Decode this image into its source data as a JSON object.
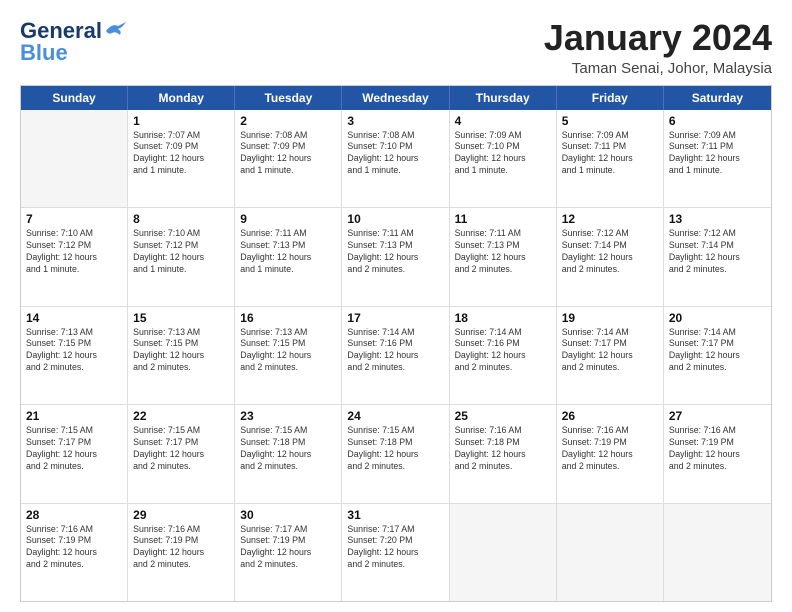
{
  "header": {
    "logo_top": "General",
    "logo_bottom": "Blue",
    "month_title": "January 2024",
    "location": "Taman Senai, Johor, Malaysia"
  },
  "calendar": {
    "days_of_week": [
      "Sunday",
      "Monday",
      "Tuesday",
      "Wednesday",
      "Thursday",
      "Friday",
      "Saturday"
    ],
    "weeks": [
      [
        {
          "day": "",
          "info": ""
        },
        {
          "day": "1",
          "info": "Sunrise: 7:07 AM\nSunset: 7:09 PM\nDaylight: 12 hours\nand 1 minute."
        },
        {
          "day": "2",
          "info": "Sunrise: 7:08 AM\nSunset: 7:09 PM\nDaylight: 12 hours\nand 1 minute."
        },
        {
          "day": "3",
          "info": "Sunrise: 7:08 AM\nSunset: 7:10 PM\nDaylight: 12 hours\nand 1 minute."
        },
        {
          "day": "4",
          "info": "Sunrise: 7:09 AM\nSunset: 7:10 PM\nDaylight: 12 hours\nand 1 minute."
        },
        {
          "day": "5",
          "info": "Sunrise: 7:09 AM\nSunset: 7:11 PM\nDaylight: 12 hours\nand 1 minute."
        },
        {
          "day": "6",
          "info": "Sunrise: 7:09 AM\nSunset: 7:11 PM\nDaylight: 12 hours\nand 1 minute."
        }
      ],
      [
        {
          "day": "7",
          "info": "Sunrise: 7:10 AM\nSunset: 7:12 PM\nDaylight: 12 hours\nand 1 minute."
        },
        {
          "day": "8",
          "info": "Sunrise: 7:10 AM\nSunset: 7:12 PM\nDaylight: 12 hours\nand 1 minute."
        },
        {
          "day": "9",
          "info": "Sunrise: 7:11 AM\nSunset: 7:13 PM\nDaylight: 12 hours\nand 1 minute."
        },
        {
          "day": "10",
          "info": "Sunrise: 7:11 AM\nSunset: 7:13 PM\nDaylight: 12 hours\nand 2 minutes."
        },
        {
          "day": "11",
          "info": "Sunrise: 7:11 AM\nSunset: 7:13 PM\nDaylight: 12 hours\nand 2 minutes."
        },
        {
          "day": "12",
          "info": "Sunrise: 7:12 AM\nSunset: 7:14 PM\nDaylight: 12 hours\nand 2 minutes."
        },
        {
          "day": "13",
          "info": "Sunrise: 7:12 AM\nSunset: 7:14 PM\nDaylight: 12 hours\nand 2 minutes."
        }
      ],
      [
        {
          "day": "14",
          "info": "Sunrise: 7:13 AM\nSunset: 7:15 PM\nDaylight: 12 hours\nand 2 minutes."
        },
        {
          "day": "15",
          "info": "Sunrise: 7:13 AM\nSunset: 7:15 PM\nDaylight: 12 hours\nand 2 minutes."
        },
        {
          "day": "16",
          "info": "Sunrise: 7:13 AM\nSunset: 7:15 PM\nDaylight: 12 hours\nand 2 minutes."
        },
        {
          "day": "17",
          "info": "Sunrise: 7:14 AM\nSunset: 7:16 PM\nDaylight: 12 hours\nand 2 minutes."
        },
        {
          "day": "18",
          "info": "Sunrise: 7:14 AM\nSunset: 7:16 PM\nDaylight: 12 hours\nand 2 minutes."
        },
        {
          "day": "19",
          "info": "Sunrise: 7:14 AM\nSunset: 7:17 PM\nDaylight: 12 hours\nand 2 minutes."
        },
        {
          "day": "20",
          "info": "Sunrise: 7:14 AM\nSunset: 7:17 PM\nDaylight: 12 hours\nand 2 minutes."
        }
      ],
      [
        {
          "day": "21",
          "info": "Sunrise: 7:15 AM\nSunset: 7:17 PM\nDaylight: 12 hours\nand 2 minutes."
        },
        {
          "day": "22",
          "info": "Sunrise: 7:15 AM\nSunset: 7:17 PM\nDaylight: 12 hours\nand 2 minutes."
        },
        {
          "day": "23",
          "info": "Sunrise: 7:15 AM\nSunset: 7:18 PM\nDaylight: 12 hours\nand 2 minutes."
        },
        {
          "day": "24",
          "info": "Sunrise: 7:15 AM\nSunset: 7:18 PM\nDaylight: 12 hours\nand 2 minutes."
        },
        {
          "day": "25",
          "info": "Sunrise: 7:16 AM\nSunset: 7:18 PM\nDaylight: 12 hours\nand 2 minutes."
        },
        {
          "day": "26",
          "info": "Sunrise: 7:16 AM\nSunset: 7:19 PM\nDaylight: 12 hours\nand 2 minutes."
        },
        {
          "day": "27",
          "info": "Sunrise: 7:16 AM\nSunset: 7:19 PM\nDaylight: 12 hours\nand 2 minutes."
        }
      ],
      [
        {
          "day": "28",
          "info": "Sunrise: 7:16 AM\nSunset: 7:19 PM\nDaylight: 12 hours\nand 2 minutes."
        },
        {
          "day": "29",
          "info": "Sunrise: 7:16 AM\nSunset: 7:19 PM\nDaylight: 12 hours\nand 2 minutes."
        },
        {
          "day": "30",
          "info": "Sunrise: 7:17 AM\nSunset: 7:19 PM\nDaylight: 12 hours\nand 2 minutes."
        },
        {
          "day": "31",
          "info": "Sunrise: 7:17 AM\nSunset: 7:20 PM\nDaylight: 12 hours\nand 2 minutes."
        },
        {
          "day": "",
          "info": ""
        },
        {
          "day": "",
          "info": ""
        },
        {
          "day": "",
          "info": ""
        }
      ]
    ]
  }
}
